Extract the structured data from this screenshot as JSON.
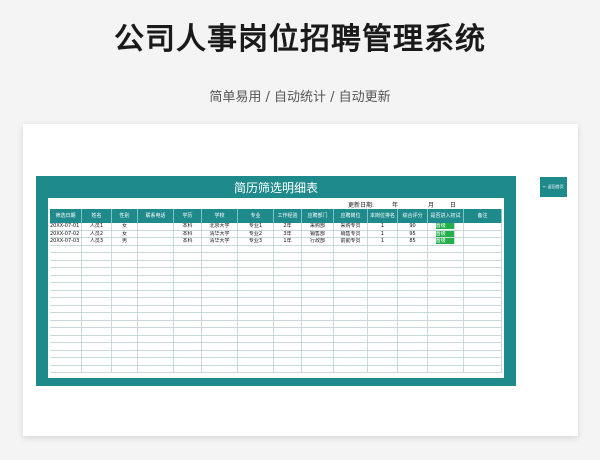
{
  "page": {
    "title": "公司人事岗位招聘管理系统",
    "subtitle": "简单易用 / 自动统计 / 自动更新"
  },
  "sheet": {
    "title": "简历筛选明细表",
    "update_label": "更新日期:",
    "year": "年",
    "month": "月",
    "day": "日"
  },
  "back_button": "← 返回首页",
  "table": {
    "columns": [
      "筛选日期",
      "姓名",
      "性别",
      "联系电话",
      "学历",
      "学校",
      "专业",
      "工作经验",
      "应聘部门",
      "应聘岗位",
      "本岗位排名",
      "综合评分",
      "是否进入初试",
      "备注"
    ],
    "rows": [
      [
        "20XX-07-01 00:00",
        "人员1",
        "女",
        "",
        "本科",
        "北京大学",
        "专业1",
        "2年",
        "采购部",
        "采购专员",
        "1",
        "90",
        "晋级",
        ""
      ],
      [
        "20XX-07-02 00:00",
        "人员2",
        "女",
        "",
        "本科",
        "清华大学",
        "专业2",
        "3年",
        "销售部",
        "销售专员",
        "1",
        "95",
        "晋级",
        ""
      ],
      [
        "20XX-07-03 00:00",
        "人员3",
        "男",
        "",
        "本科",
        "清华大学",
        "专业3",
        "1年",
        "行政部",
        "前勤专员",
        "1",
        "85",
        "晋级",
        ""
      ]
    ],
    "empty_rows": 17
  },
  "colors": {
    "teal": "#1f8a8c",
    "pass_green": "#22b04a"
  }
}
